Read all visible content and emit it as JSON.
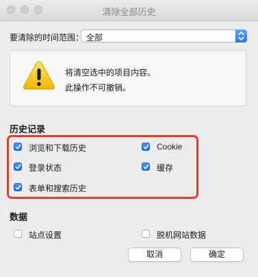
{
  "window": {
    "title": "清除全部历史"
  },
  "range": {
    "label": "要清除的时间范围：",
    "value": "全部"
  },
  "warning": {
    "line1": "将清空选中的项目内容。",
    "line2": "此操作不可撤销。"
  },
  "history": {
    "title": "历史记录",
    "items": [
      {
        "label": "浏览和下载历史",
        "checked": true
      },
      {
        "label": "Cookie",
        "checked": true
      },
      {
        "label": "登录状态",
        "checked": true
      },
      {
        "label": "缓存",
        "checked": true
      },
      {
        "label": "表单和搜索历史",
        "checked": true
      }
    ]
  },
  "data_section": {
    "title": "数据",
    "items": [
      {
        "label": "站点设置",
        "checked": false
      },
      {
        "label": "脱机网站数据",
        "checked": false
      }
    ]
  },
  "buttons": {
    "cancel": "取消",
    "ok": "确定"
  },
  "colors": {
    "accent": "#2a72f0",
    "highlight": "#e8392d",
    "warning": "#f5c518"
  }
}
